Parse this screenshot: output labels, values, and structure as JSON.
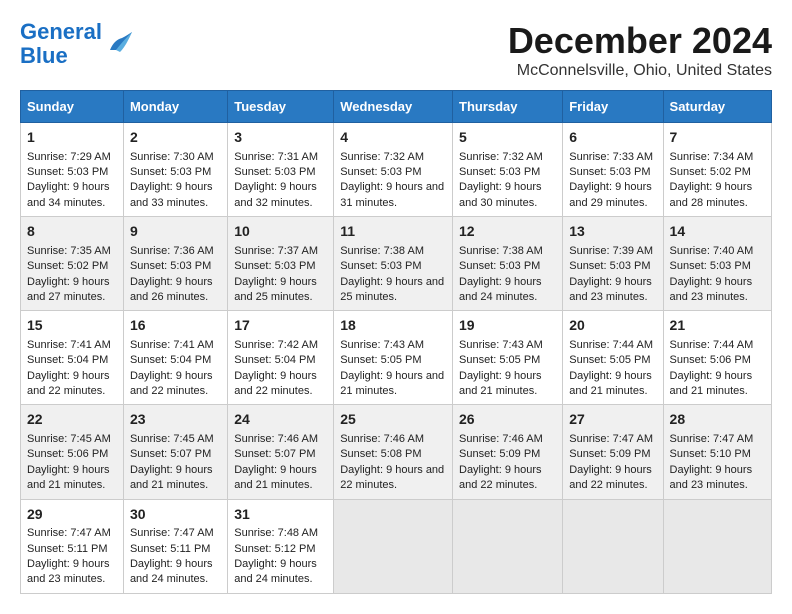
{
  "header": {
    "logo_line1": "General",
    "logo_line2": "Blue",
    "title": "December 2024",
    "subtitle": "McConnelsville, Ohio, United States"
  },
  "days_of_week": [
    "Sunday",
    "Monday",
    "Tuesday",
    "Wednesday",
    "Thursday",
    "Friday",
    "Saturday"
  ],
  "weeks": [
    [
      {
        "day": "1",
        "info": "Sunrise: 7:29 AM\nSunset: 5:03 PM\nDaylight: 9 hours and 34 minutes."
      },
      {
        "day": "2",
        "info": "Sunrise: 7:30 AM\nSunset: 5:03 PM\nDaylight: 9 hours and 33 minutes."
      },
      {
        "day": "3",
        "info": "Sunrise: 7:31 AM\nSunset: 5:03 PM\nDaylight: 9 hours and 32 minutes."
      },
      {
        "day": "4",
        "info": "Sunrise: 7:32 AM\nSunset: 5:03 PM\nDaylight: 9 hours and 31 minutes."
      },
      {
        "day": "5",
        "info": "Sunrise: 7:32 AM\nSunset: 5:03 PM\nDaylight: 9 hours and 30 minutes."
      },
      {
        "day": "6",
        "info": "Sunrise: 7:33 AM\nSunset: 5:03 PM\nDaylight: 9 hours and 29 minutes."
      },
      {
        "day": "7",
        "info": "Sunrise: 7:34 AM\nSunset: 5:02 PM\nDaylight: 9 hours and 28 minutes."
      }
    ],
    [
      {
        "day": "8",
        "info": "Sunrise: 7:35 AM\nSunset: 5:02 PM\nDaylight: 9 hours and 27 minutes."
      },
      {
        "day": "9",
        "info": "Sunrise: 7:36 AM\nSunset: 5:03 PM\nDaylight: 9 hours and 26 minutes."
      },
      {
        "day": "10",
        "info": "Sunrise: 7:37 AM\nSunset: 5:03 PM\nDaylight: 9 hours and 25 minutes."
      },
      {
        "day": "11",
        "info": "Sunrise: 7:38 AM\nSunset: 5:03 PM\nDaylight: 9 hours and 25 minutes."
      },
      {
        "day": "12",
        "info": "Sunrise: 7:38 AM\nSunset: 5:03 PM\nDaylight: 9 hours and 24 minutes."
      },
      {
        "day": "13",
        "info": "Sunrise: 7:39 AM\nSunset: 5:03 PM\nDaylight: 9 hours and 23 minutes."
      },
      {
        "day": "14",
        "info": "Sunrise: 7:40 AM\nSunset: 5:03 PM\nDaylight: 9 hours and 23 minutes."
      }
    ],
    [
      {
        "day": "15",
        "info": "Sunrise: 7:41 AM\nSunset: 5:04 PM\nDaylight: 9 hours and 22 minutes."
      },
      {
        "day": "16",
        "info": "Sunrise: 7:41 AM\nSunset: 5:04 PM\nDaylight: 9 hours and 22 minutes."
      },
      {
        "day": "17",
        "info": "Sunrise: 7:42 AM\nSunset: 5:04 PM\nDaylight: 9 hours and 22 minutes."
      },
      {
        "day": "18",
        "info": "Sunrise: 7:43 AM\nSunset: 5:05 PM\nDaylight: 9 hours and 21 minutes."
      },
      {
        "day": "19",
        "info": "Sunrise: 7:43 AM\nSunset: 5:05 PM\nDaylight: 9 hours and 21 minutes."
      },
      {
        "day": "20",
        "info": "Sunrise: 7:44 AM\nSunset: 5:05 PM\nDaylight: 9 hours and 21 minutes."
      },
      {
        "day": "21",
        "info": "Sunrise: 7:44 AM\nSunset: 5:06 PM\nDaylight: 9 hours and 21 minutes."
      }
    ],
    [
      {
        "day": "22",
        "info": "Sunrise: 7:45 AM\nSunset: 5:06 PM\nDaylight: 9 hours and 21 minutes."
      },
      {
        "day": "23",
        "info": "Sunrise: 7:45 AM\nSunset: 5:07 PM\nDaylight: 9 hours and 21 minutes."
      },
      {
        "day": "24",
        "info": "Sunrise: 7:46 AM\nSunset: 5:07 PM\nDaylight: 9 hours and 21 minutes."
      },
      {
        "day": "25",
        "info": "Sunrise: 7:46 AM\nSunset: 5:08 PM\nDaylight: 9 hours and 22 minutes."
      },
      {
        "day": "26",
        "info": "Sunrise: 7:46 AM\nSunset: 5:09 PM\nDaylight: 9 hours and 22 minutes."
      },
      {
        "day": "27",
        "info": "Sunrise: 7:47 AM\nSunset: 5:09 PM\nDaylight: 9 hours and 22 minutes."
      },
      {
        "day": "28",
        "info": "Sunrise: 7:47 AM\nSunset: 5:10 PM\nDaylight: 9 hours and 23 minutes."
      }
    ],
    [
      {
        "day": "29",
        "info": "Sunrise: 7:47 AM\nSunset: 5:11 PM\nDaylight: 9 hours and 23 minutes."
      },
      {
        "day": "30",
        "info": "Sunrise: 7:47 AM\nSunset: 5:11 PM\nDaylight: 9 hours and 24 minutes."
      },
      {
        "day": "31",
        "info": "Sunrise: 7:48 AM\nSunset: 5:12 PM\nDaylight: 9 hours and 24 minutes."
      },
      null,
      null,
      null,
      null
    ]
  ]
}
